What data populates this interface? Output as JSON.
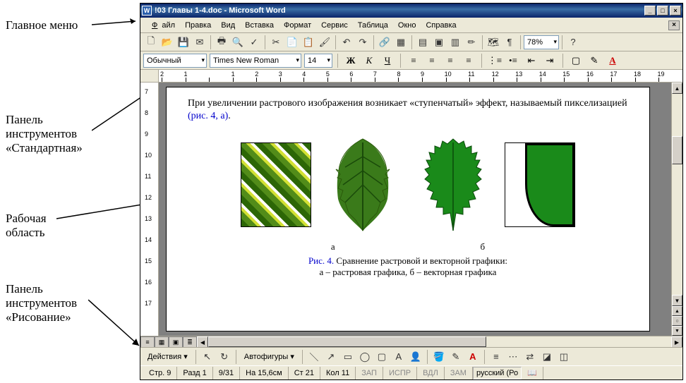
{
  "annotations": {
    "main_menu": "Главное меню",
    "standard_toolbar_1": "Панель",
    "standard_toolbar_2": "инструментов",
    "standard_toolbar_3": "«Стандартная»",
    "work_area_1": "Рабочая",
    "work_area_2": "область",
    "drawing_toolbar_1": "Панель",
    "drawing_toolbar_2": "инструментов",
    "drawing_toolbar_3": "«Рисование»"
  },
  "titlebar": {
    "title": "!03 Главы 1-4.doc - Microsoft Word",
    "icon_letter": "W"
  },
  "menu": {
    "file": "Файл",
    "edit": "Правка",
    "view": "Вид",
    "insert": "Вставка",
    "format": "Формат",
    "tools": "Сервис",
    "table": "Таблица",
    "window": "Окно",
    "help": "Справка"
  },
  "standard_toolbar": {
    "zoom": "78%"
  },
  "formatting": {
    "style": "Обычный",
    "font": "Times New Roman",
    "size": "14",
    "bold": "Ж",
    "italic": "К",
    "underline": "Ч"
  },
  "ruler_h": [
    "2",
    "1",
    "",
    "1",
    "2",
    "3",
    "4",
    "5",
    "6",
    "7",
    "8",
    "9",
    "10",
    "11",
    "12",
    "13",
    "14",
    "15",
    "16",
    "17",
    "18",
    "19"
  ],
  "ruler_v": [
    "7",
    "8",
    "9",
    "10",
    "11",
    "12",
    "13",
    "14",
    "15",
    "16",
    "17"
  ],
  "document": {
    "para1": "При увеличении растрового изображения возникает «ступенчатый» эффект, называемый пикселизацией ",
    "para1_link": "(рис. 4, а)",
    "label_a": "а",
    "label_b": "б",
    "caption_prefix": "Рис. 4.",
    "caption_line1": " Сравнение растровой и векторной графики:",
    "caption_line2": "а – растровая графика, б – векторная графика"
  },
  "drawing": {
    "actions": "Действия",
    "autoshapes": "Автофигуры"
  },
  "status": {
    "page": "Стр. 9",
    "section": "Разд 1",
    "pages": "9/31",
    "position": "На 15,6см",
    "line": "Ст 21",
    "column": "Кол 11",
    "rec": "ЗАП",
    "trk": "ИСПР",
    "ext": "ВДЛ",
    "ovr": "ЗАМ",
    "lang": "русский (Ро"
  }
}
